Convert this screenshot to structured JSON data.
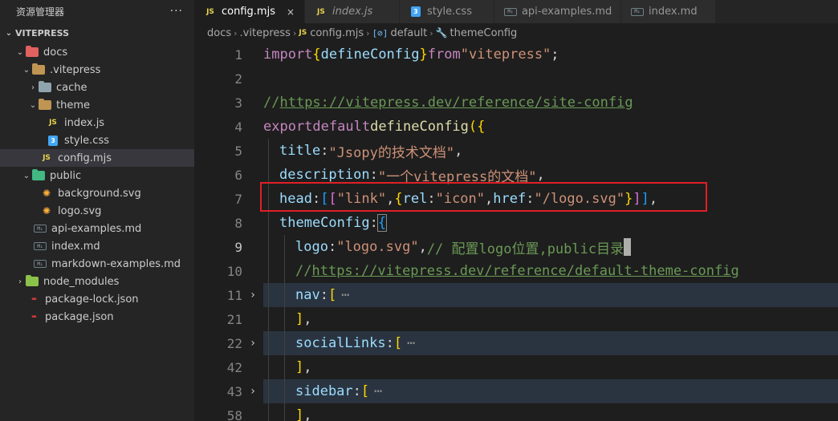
{
  "explorer": {
    "title": "资源管理器",
    "more": "···",
    "section": "VITEPRESS",
    "items": [
      {
        "label": "docs",
        "chevron": "⌄",
        "icon": "folder-docs-icon"
      },
      {
        "label": ".vitepress",
        "chevron": "⌄",
        "icon": "folder-vitepress-icon"
      },
      {
        "label": "cache",
        "chevron": "›",
        "icon": "folder-cache-icon"
      },
      {
        "label": "theme",
        "chevron": "⌄",
        "icon": "folder-theme-icon"
      },
      {
        "label": "index.js",
        "icon": "js-file-icon"
      },
      {
        "label": "style.css",
        "icon": "css-file-icon"
      },
      {
        "label": "config.mjs",
        "icon": "js-file-icon"
      },
      {
        "label": "public",
        "chevron": "⌄",
        "icon": "folder-public-icon"
      },
      {
        "label": "background.svg",
        "icon": "svg-file-icon"
      },
      {
        "label": "logo.svg",
        "icon": "svg-file-icon"
      },
      {
        "label": "api-examples.md",
        "icon": "markdown-file-icon"
      },
      {
        "label": "index.md",
        "icon": "markdown-file-icon"
      },
      {
        "label": "markdown-examples.md",
        "icon": "markdown-file-icon"
      },
      {
        "label": "node_modules",
        "chevron": "›",
        "icon": "folder-node-modules-icon"
      },
      {
        "label": "package-lock.json",
        "icon": "json-file-icon"
      },
      {
        "label": "package.json",
        "icon": "json-file-icon"
      }
    ]
  },
  "tabs": [
    {
      "label": "config.mjs",
      "close": "×",
      "icon_text": "JS"
    },
    {
      "label": "index.js",
      "icon_text": "JS"
    },
    {
      "label": "style.css",
      "icon_text": "3"
    },
    {
      "label": "api-examples.md",
      "icon_text": "M↓"
    },
    {
      "label": "index.md",
      "icon_text": "M↓"
    }
  ],
  "breadcrumb": {
    "items": [
      "docs",
      ".vitepress",
      "config.mjs",
      "default",
      "themeConfig"
    ],
    "js_icon": "JS",
    "default_icon": "[⊘]",
    "theme_icon": "🔧"
  },
  "editor": {
    "line_numbers": [
      "1",
      "2",
      "3",
      "4",
      "5",
      "6",
      "7",
      "8",
      "9",
      "10",
      "11",
      "21",
      "22",
      "42",
      "43",
      "58"
    ],
    "fold_marker": "›",
    "code": {
      "l1": {
        "import": "import",
        "open": "{",
        "name": "defineConfig",
        "close": "}",
        "from": "from",
        "module": "\"vitepress\"",
        "semi": ";"
      },
      "l3": {
        "slashes": "//",
        "url": "https://vitepress.dev/reference/site-config"
      },
      "l4": {
        "export": "export",
        "default": "default",
        "fn": "defineConfig",
        "open": "({"
      },
      "l5": {
        "key": "title",
        "colon": ":",
        "value": "\"Jsopy的技术文档\"",
        "comma": ","
      },
      "l6": {
        "key": "description",
        "colon": ":",
        "value": "\"一个vitepress的文档\"",
        "comma": ","
      },
      "l7": {
        "key": "head",
        "colon": ":",
        "o1": "[",
        "o2": "[",
        "s1": "\"link\"",
        "c1": ",",
        "o3": "{",
        "k1": "rel",
        "col1": ":",
        "s2": "\"icon\"",
        "c2": ",",
        "k2": "href",
        "col2": ":",
        "s3": "\"/logo.svg\"",
        "cl3": "}",
        "cl2": "]",
        "cl1": "]",
        "comma": ","
      },
      "l8": {
        "key": "themeConfig",
        "colon": ":",
        "open": "{"
      },
      "l9": {
        "key": "logo",
        "colon": ":",
        "value": "\"logo.svg\"",
        "comma": ",",
        "comment": "// 配置logo位置,public目录"
      },
      "l10": {
        "slashes": "//",
        "url": "https://vitepress.dev/reference/default-theme-config"
      },
      "l11": {
        "key": "nav",
        "colon": ":",
        "open": "[",
        "ellipsis": "⋯"
      },
      "l21": {
        "close": "]",
        "comma": ","
      },
      "l22": {
        "key": "socialLinks",
        "colon": ":",
        "open": "[",
        "ellipsis": "⋯"
      },
      "l42": {
        "close": "]",
        "comma": ","
      },
      "l43": {
        "key": "sidebar",
        "colon": ":",
        "open": "[",
        "ellipsis": "⋯"
      },
      "l58": {
        "close": "]",
        "comma": ","
      }
    }
  },
  "colors": {
    "accent_highlight": "#e01f26",
    "editor_bg": "#1e1e1e",
    "sidebar_bg": "#252526"
  }
}
